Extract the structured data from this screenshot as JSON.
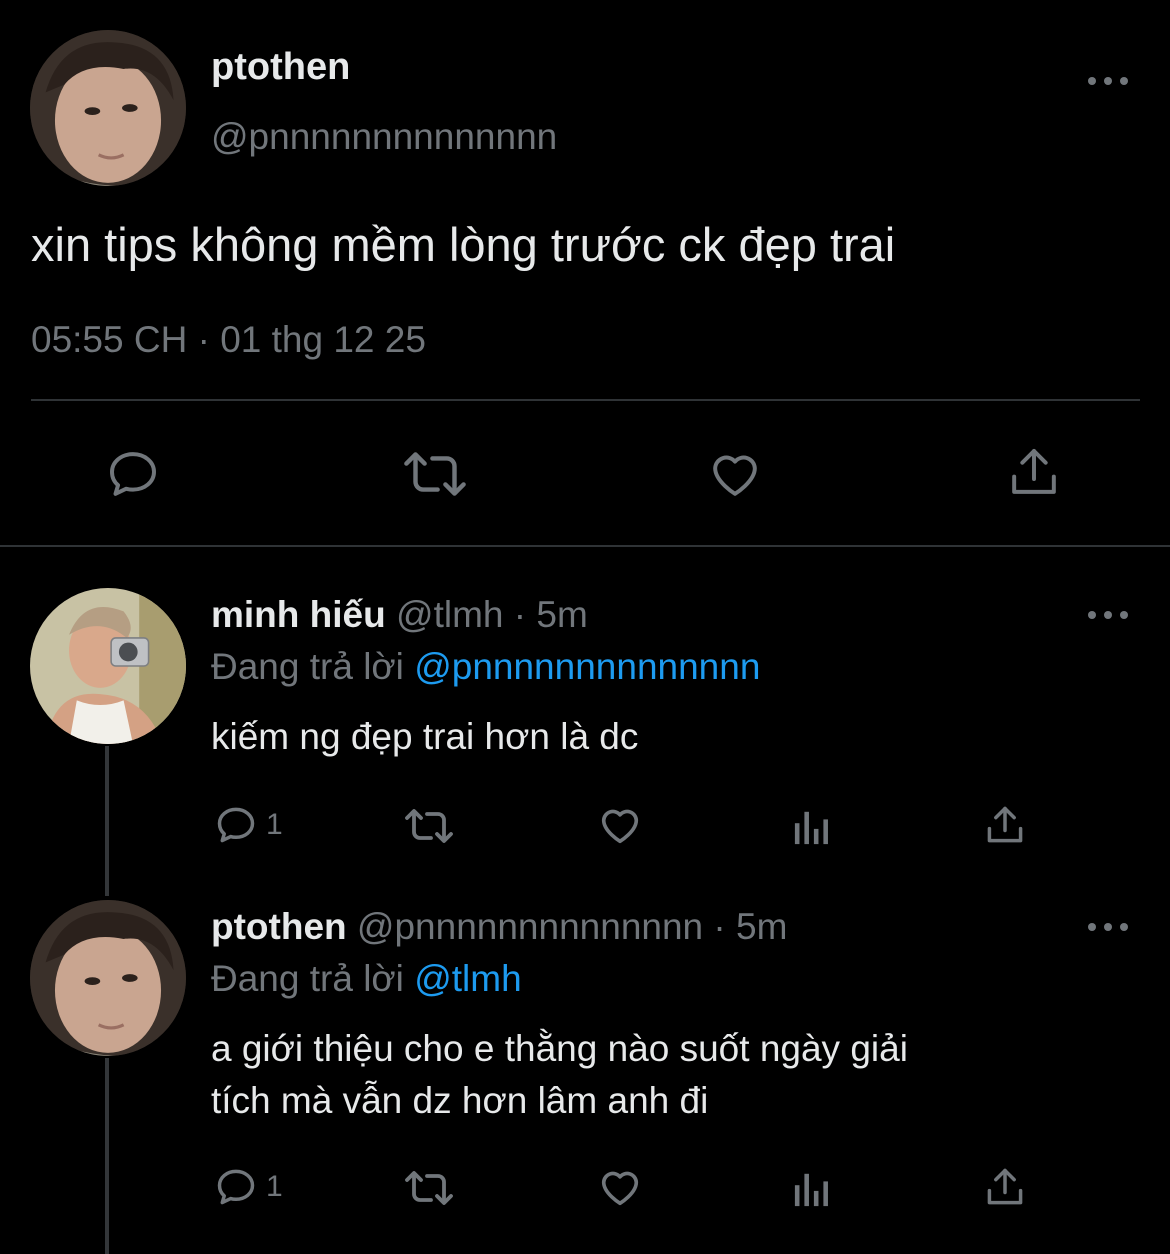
{
  "main_tweet": {
    "name": "ptothen",
    "handle": "@pnnnnnnnnnnnnnn",
    "text": "xin tips không mềm lòng trước ck đẹp trai",
    "timestamp": "05:55 CH · 01 thg 12 25",
    "actions": [
      "reply-icon",
      "retweet-icon",
      "like-icon",
      "share-icon"
    ]
  },
  "replies": [
    {
      "name": "minh hiếu",
      "handle": "@tlmh",
      "dot": "·",
      "time": "5m",
      "replying_prefix": "Đang trả lời",
      "replying_to": "@pnnnnnnnnnnnnnn",
      "text": "kiếm ng đẹp trai hơn là dc",
      "reply_count": "1"
    },
    {
      "name": "ptothen",
      "handle": "@pnnnnnnnnnnnnnn",
      "dot": "·",
      "time": "5m",
      "replying_prefix": "Đang trả lời",
      "replying_to": "@tlmh",
      "text_line1": "a giới thiệu cho e thằng nào suốt ngày giải",
      "text_line2": "tích mà vẫn dz hơn lâm anh đi",
      "reply_count": "1"
    }
  ],
  "colors": {
    "background": "#000000",
    "text": "#e7e9ea",
    "secondary": "#71767b",
    "mention": "#1d9bf0",
    "divider": "#2f3336"
  }
}
